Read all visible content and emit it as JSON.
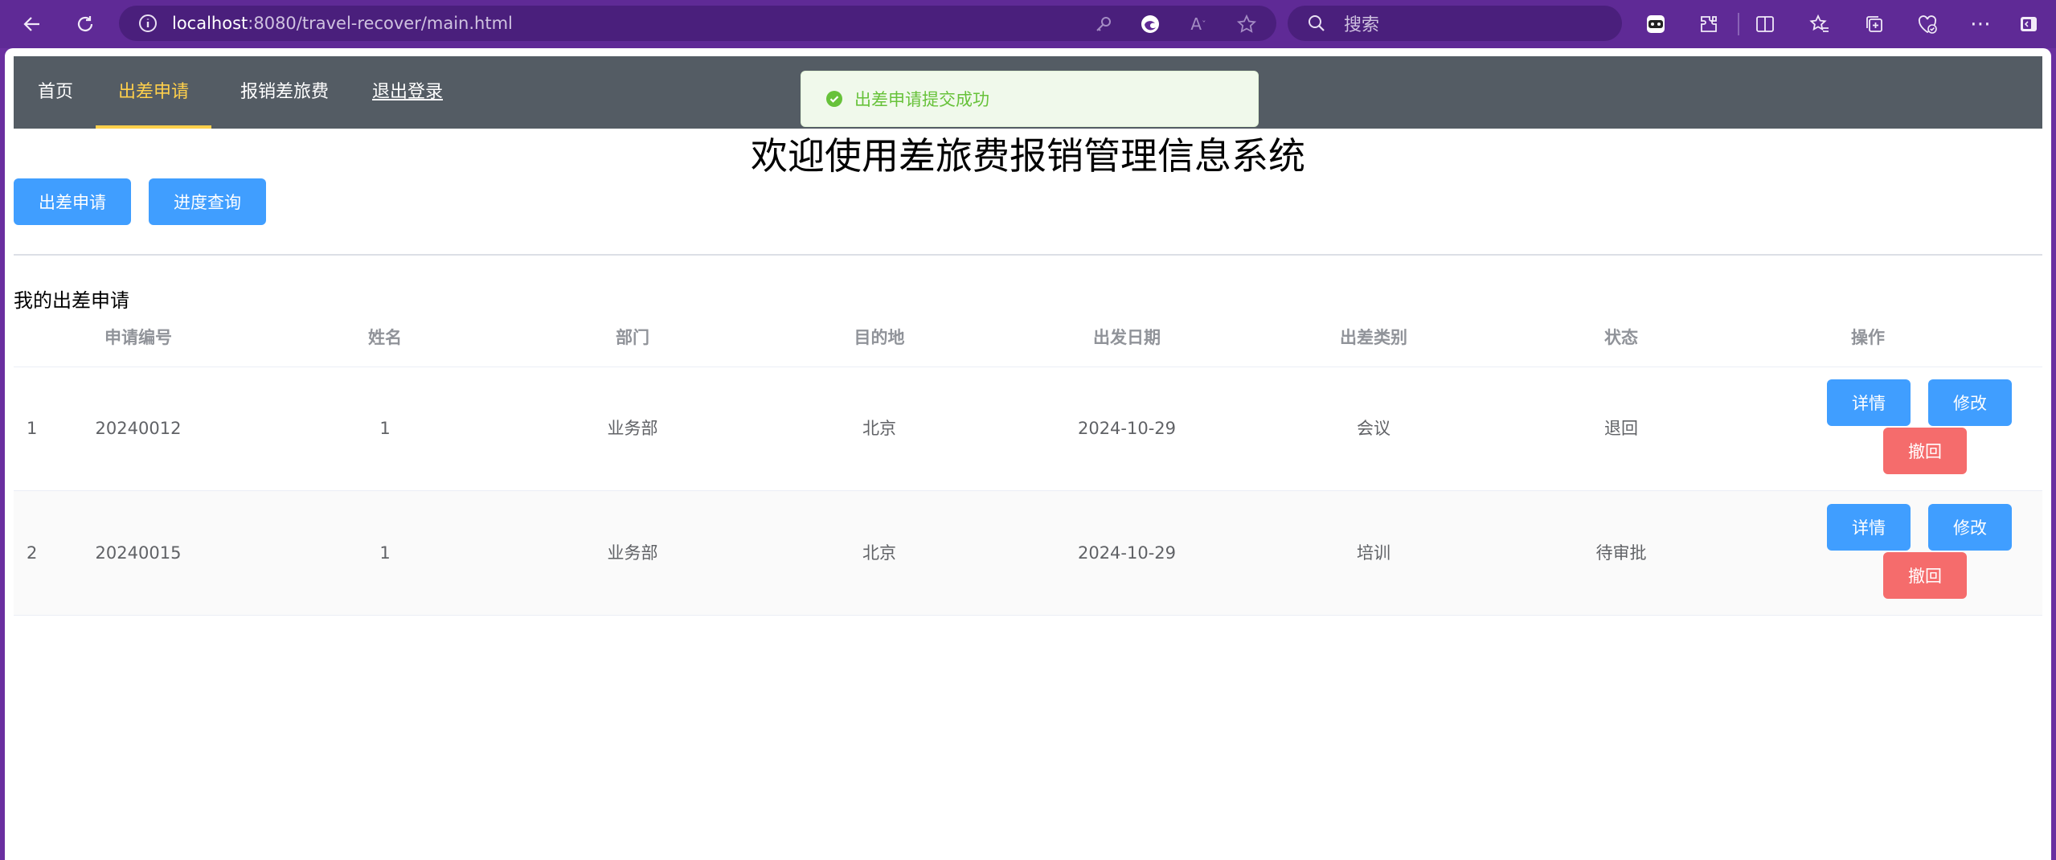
{
  "browser": {
    "url_host": "localhost",
    "url_path": ":8080/travel-recover/main.html",
    "search_placeholder": "搜索"
  },
  "nav": {
    "items": [
      "首页",
      "出差申请",
      "报销差旅费",
      "退出登录"
    ],
    "active": "出差申请",
    "active_color": "#ffd04b",
    "background": "#545c64"
  },
  "toast": {
    "message": "出差申请提交成功",
    "type": "success"
  },
  "page_title": "欢迎使用差旅费报销管理信息系统",
  "actions": {
    "apply_label": "出差申请",
    "progress_label": "进度查询"
  },
  "section_title": "我的出差申请",
  "table": {
    "columns": [
      "申请编号",
      "姓名",
      "部门",
      "目的地",
      "出发日期",
      "出差类别",
      "状态",
      "操作"
    ],
    "rows": [
      {
        "index": "1",
        "id": "20240012",
        "name": "1",
        "dept": "业务部",
        "dest": "北京",
        "date": "2024-10-29",
        "category": "会议",
        "status": "退回"
      },
      {
        "index": "2",
        "id": "20240015",
        "name": "1",
        "dept": "业务部",
        "dest": "北京",
        "date": "2024-10-29",
        "category": "培训",
        "status": "待审批"
      }
    ],
    "row_buttons": {
      "detail": "详情",
      "edit": "修改",
      "withdraw": "撤回"
    }
  },
  "colors": {
    "primary": "#409eff",
    "danger": "#f56c6c",
    "success": "#67c23a",
    "browser_frame": "#6a2fa0"
  }
}
